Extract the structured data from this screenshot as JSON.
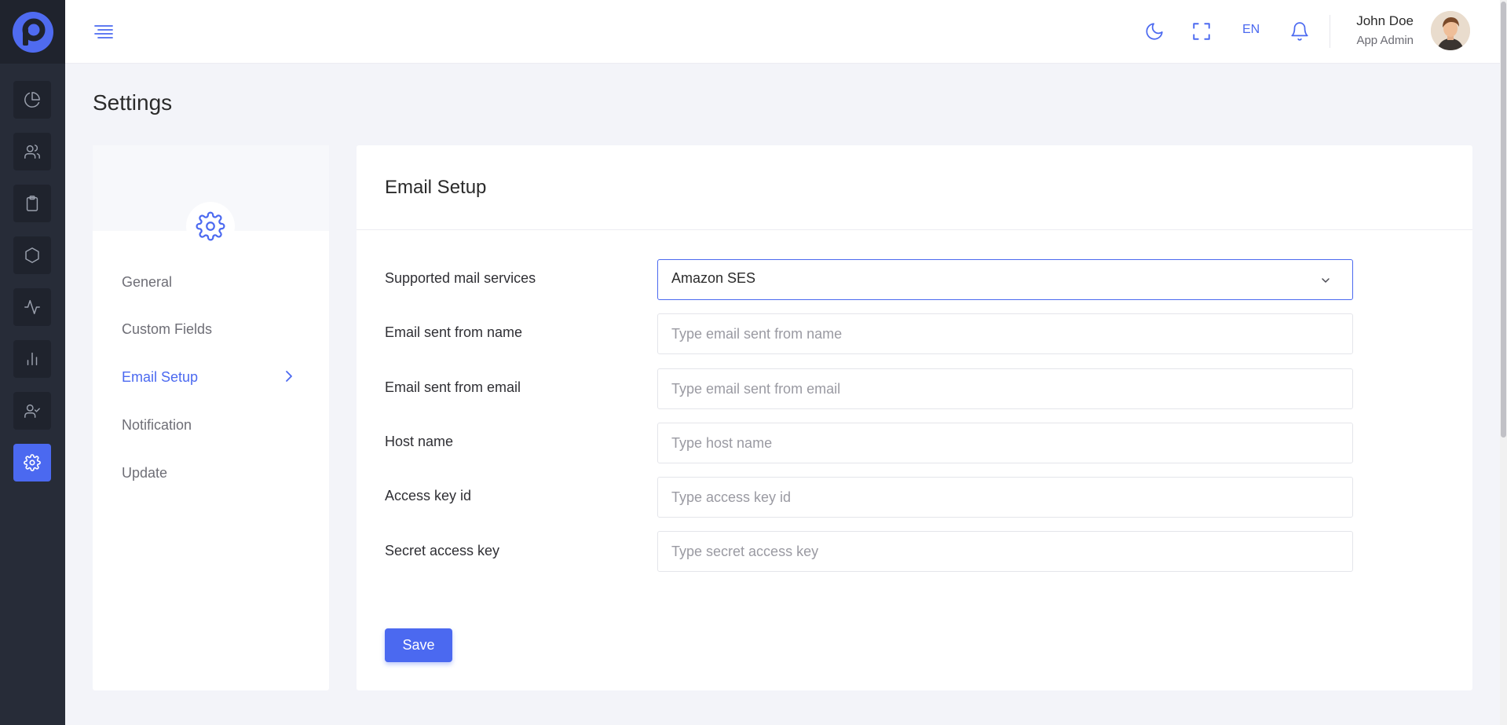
{
  "header": {
    "language": "EN",
    "user_name": "John Doe",
    "user_role": "App Admin"
  },
  "sidebar": {
    "icons": [
      "dashboard-icon",
      "users-icon",
      "clipboard-icon",
      "hexagon-icon",
      "activity-icon",
      "bar-chart-icon",
      "user-check-icon",
      "settings-icon"
    ],
    "active": "settings-icon"
  },
  "page": {
    "title": "Settings"
  },
  "settings_nav": {
    "items": [
      {
        "label": "General"
      },
      {
        "label": "Custom Fields"
      },
      {
        "label": "Email Setup"
      },
      {
        "label": "Notification"
      },
      {
        "label": "Update"
      }
    ],
    "active": "Email Setup"
  },
  "email_setup": {
    "title": "Email Setup",
    "fields": [
      {
        "label": "Supported mail services",
        "value": "Amazon SES"
      },
      {
        "label": "Email sent from name",
        "placeholder": "Type email sent from name"
      },
      {
        "label": "Email sent from email",
        "placeholder": "Type email sent from email"
      },
      {
        "label": "Host name",
        "placeholder": "Type host name"
      },
      {
        "label": "Access key id",
        "placeholder": "Type access key id"
      },
      {
        "label": "Secret access key",
        "placeholder": "Type secret access key"
      }
    ],
    "save_label": "Save"
  },
  "colors": {
    "accent": "#4b69f0",
    "rail_background": "#272c38",
    "page_background": "#f3f4f9"
  }
}
